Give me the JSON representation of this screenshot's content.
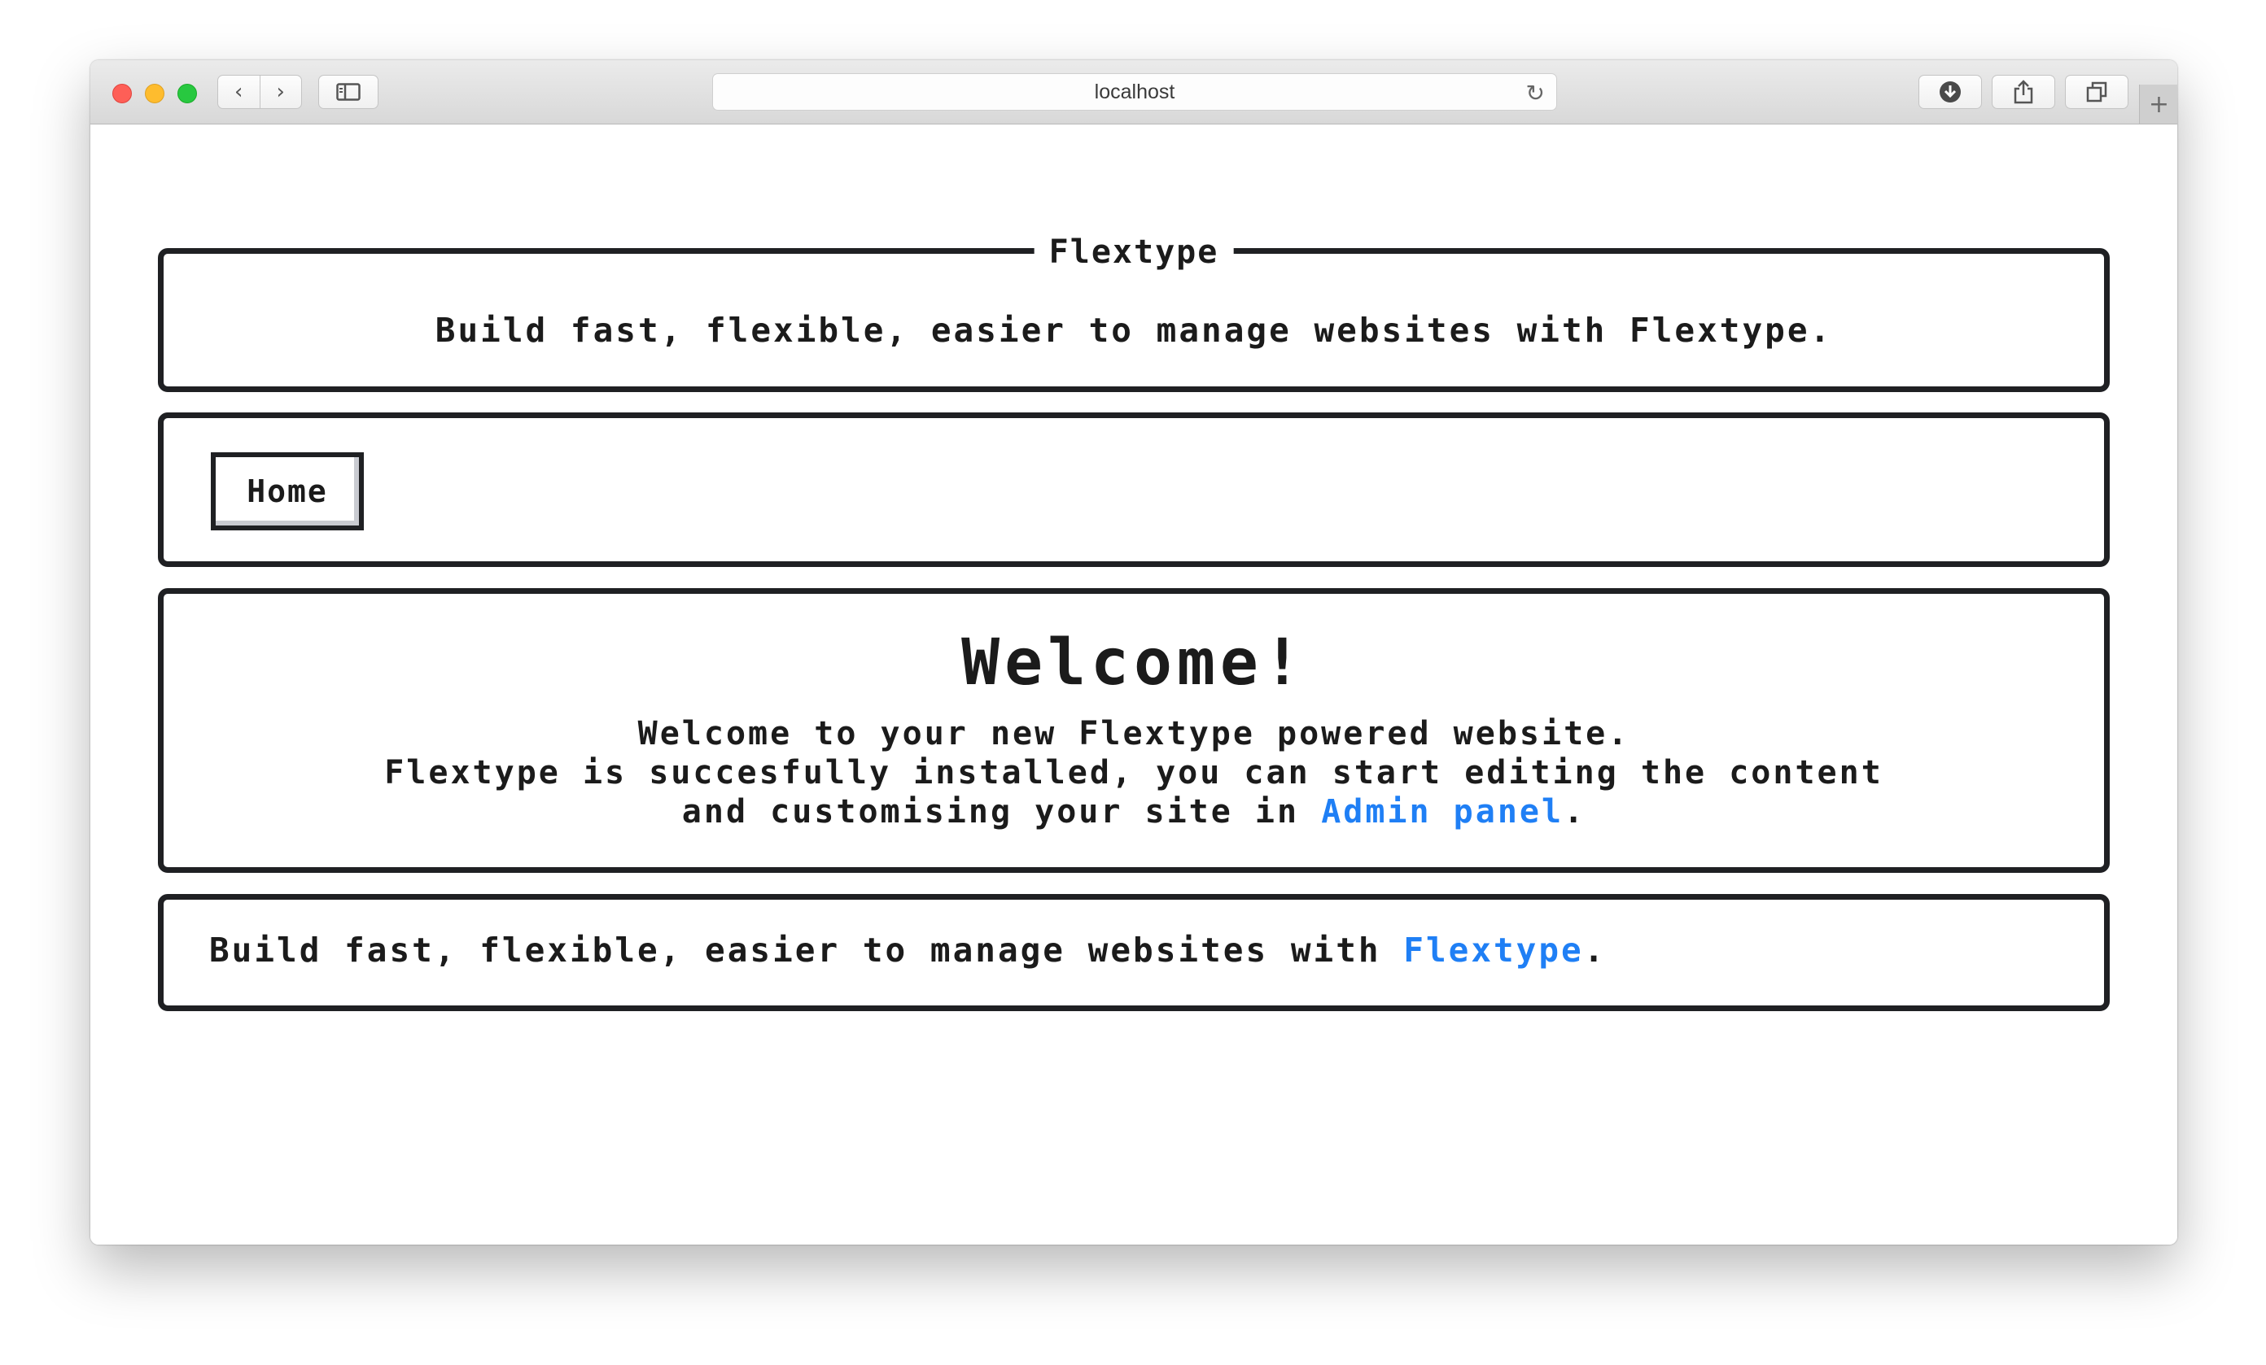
{
  "browser": {
    "url": "localhost",
    "icons": {
      "back": "chevron-left-icon",
      "forward": "chevron-right-icon",
      "sidebar": "sidebar-icon",
      "reload": "reload-icon",
      "download": "download-icon",
      "share": "share-icon",
      "tabs": "tabs-icon",
      "new_tab": "plus-icon"
    },
    "traffic_colors": {
      "close": "#fe5f57",
      "minimize": "#febc2e",
      "zoom": "#28c840"
    }
  },
  "header": {
    "site_name": "Flextype",
    "tagline": "Build fast, flexible, easier to manage websites with Flextype."
  },
  "nav": {
    "items": [
      {
        "label": "Home"
      }
    ]
  },
  "main": {
    "title": "Welcome!",
    "line1": "Welcome to your new Flextype powered website.",
    "line2": "Flextype is succesfully installed, you can start editing the content",
    "line3_prefix": "and customising your site in ",
    "admin_link": "Admin panel",
    "line3_suffix": "."
  },
  "footer": {
    "text_prefix": "Build fast, flexible, easier to manage websites with ",
    "link": "Flextype",
    "text_suffix": "."
  },
  "colors": {
    "link": "#1f7ff5",
    "border": "#1f2023",
    "text": "#1b1b1b"
  }
}
